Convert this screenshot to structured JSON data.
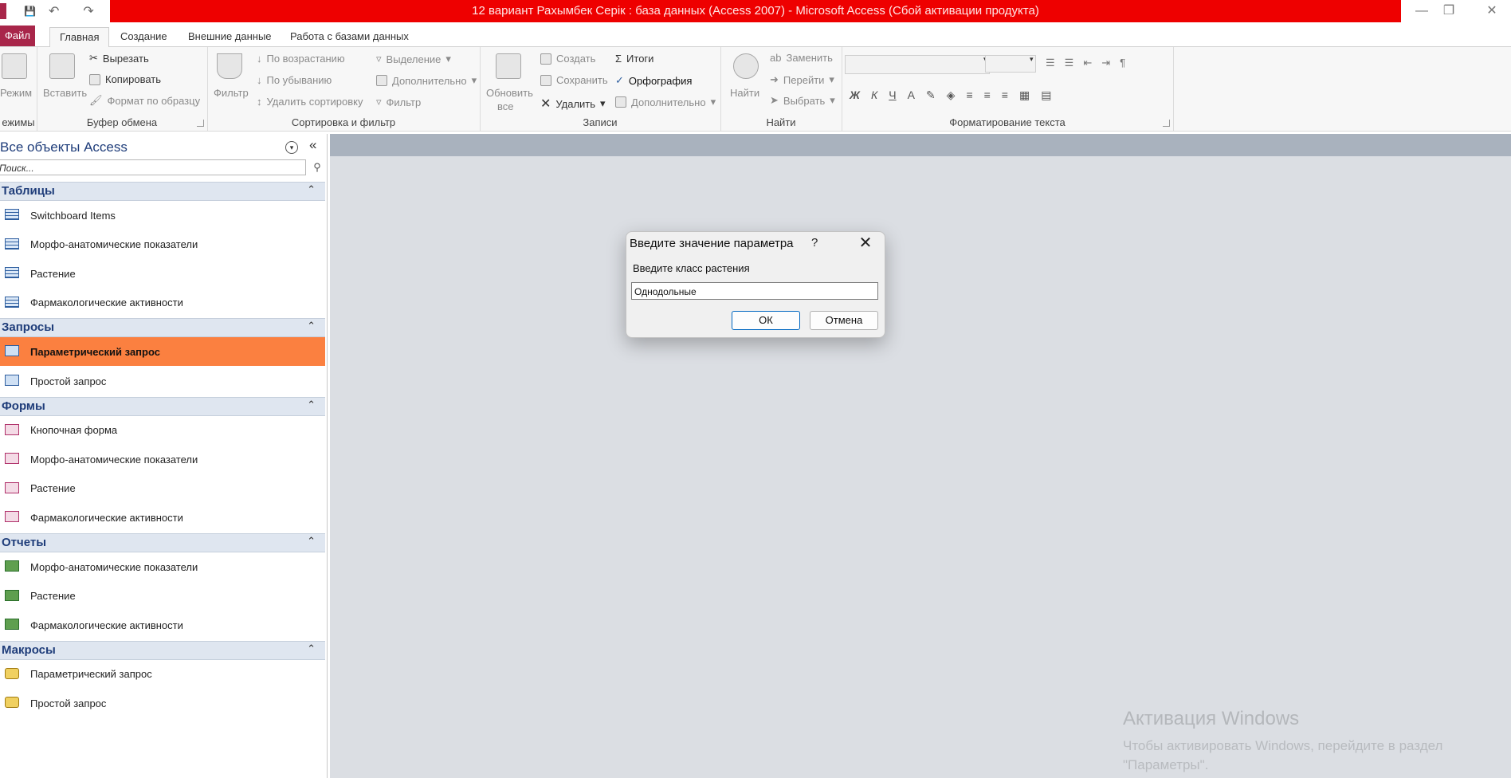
{
  "window": {
    "title": "12 вариант Рахымбек Серік : база данных (Access 2007)  -  Microsoft Access (Сбой активации продукта)",
    "controls": {
      "minimize": "—",
      "restore": "❐",
      "close": "✕"
    }
  },
  "qat": {
    "save": "💾",
    "undo": "↶",
    "redo": "↷",
    "more": "▾"
  },
  "tabs": [
    {
      "label": "Файл"
    },
    {
      "label": "Главная"
    },
    {
      "label": "Создание"
    },
    {
      "label": "Внешние данные"
    },
    {
      "label": "Работа с базами данных"
    }
  ],
  "tab_right": {
    "collapse": "⌃",
    "help": "?"
  },
  "ribbon": {
    "views": {
      "label": "Режим",
      "group": "ежимы"
    },
    "clipboard": {
      "paste": "Вставить",
      "cut": "Вырезать",
      "copy": "Копировать",
      "format_painter": "Формат по образцу",
      "group": "Буфер обмена"
    },
    "sort_filter": {
      "filter": "Фильтр",
      "ascending": "По возрастанию",
      "descending": "По убыванию",
      "remove_sort": "Удалить сортировку",
      "selection": "Выделение",
      "advanced": "Дополнительно",
      "toggle_filter": "Фильтр",
      "group": "Сортировка и фильтр"
    },
    "records": {
      "refresh_line1": "Обновить",
      "refresh_line2": "все",
      "new": "Создать",
      "save": "Сохранить",
      "delete": "Удалить",
      "totals": "Итоги",
      "spelling": "Орфография",
      "more": "Дополнительно",
      "group": "Записи"
    },
    "find": {
      "find": "Найти",
      "replace": "Заменить",
      "goto": "Перейти",
      "select": "Выбрать",
      "group": "Найти"
    },
    "text_formatting": {
      "bold": "Ж",
      "italic": "К",
      "underline": "Ч",
      "font_color": "А",
      "group": "Форматирование текста"
    }
  },
  "nav": {
    "title": "Все объекты Access",
    "search_placeholder": "Поиск...",
    "sections": [
      {
        "title": "Таблицы",
        "type": "table",
        "items": [
          "Switchboard Items",
          "Морфо-анатомические показатели",
          "Растение",
          "Фармакологические активности"
        ]
      },
      {
        "title": "Запросы",
        "type": "query",
        "items": [
          "Параметрический запрос",
          "Простой запрос"
        ]
      },
      {
        "title": "Формы",
        "type": "form",
        "items": [
          "Кнопочная форма",
          "Морфо-анатомические показатели",
          "Растение",
          "Фармакологические активности"
        ]
      },
      {
        "title": "Отчеты",
        "type": "report",
        "items": [
          "Морфо-анатомические показатели",
          "Растение",
          "Фармакологические активности"
        ]
      },
      {
        "title": "Макросы",
        "type": "macro",
        "items": [
          "Параметрический запрос",
          "Простой запрос"
        ]
      }
    ],
    "selected": "Параметрический запрос"
  },
  "dialog": {
    "title": "Введите значение параметра",
    "help": "?",
    "prompt": "Введите класс растения",
    "value": "Однодольные",
    "ok": "ОК",
    "cancel": "Отмена"
  },
  "watermark": {
    "title": "Активация Windows",
    "text": "Чтобы активировать Windows, перейдите в раздел \"Параметры\"."
  },
  "colors": {
    "title_bar": "#ee0000",
    "file_tab": "#a8264a",
    "selected_item": "#fb8040",
    "section_header": "#dfe6f0"
  }
}
